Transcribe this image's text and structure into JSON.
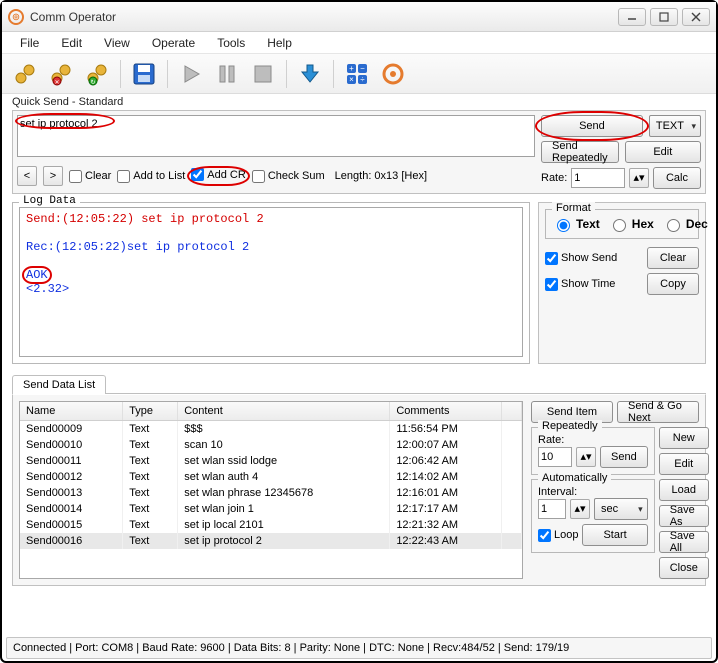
{
  "window": {
    "title": "Comm Operator"
  },
  "menu": [
    "File",
    "Edit",
    "View",
    "Operate",
    "Tools",
    "Help"
  ],
  "quicksend": {
    "panel_label": "Quick Send - Standard",
    "text": "set ip protocol 2",
    "clear": "Clear",
    "add_to_list": "Add to List",
    "add_cr": "Add CR",
    "checksum": "Check Sum",
    "length": "Length: 0x13 [Hex]",
    "send": "Send",
    "send_rep": "Send Repeatedly",
    "mode": "TEXT",
    "edit": "Edit",
    "rate_label": "Rate:",
    "rate_value": "1",
    "calc": "Calc"
  },
  "log": {
    "title": "Log Data",
    "line_send": "Send:(12:05:22) set ip protocol 2",
    "line_rec": "Rec:(12:05:22)set ip protocol 2",
    "line_aok": "AOK",
    "line_ver": "<2.32>"
  },
  "format": {
    "title": "Format",
    "text": "Text",
    "hex": "Hex",
    "dec": "Dec",
    "show_send": "Show Send",
    "show_time": "Show Time",
    "clear": "Clear",
    "copy": "Copy"
  },
  "sendlist": {
    "tab": "Send Data List",
    "cols": {
      "name": "Name",
      "type": "Type",
      "content": "Content",
      "comments": "Comments"
    },
    "rows": [
      {
        "name": "Send00009",
        "type": "Text",
        "content": "$$$",
        "comments": "11:56:54 PM"
      },
      {
        "name": "Send00010",
        "type": "Text",
        "content": "scan 10",
        "comments": "12:00:07 AM"
      },
      {
        "name": "Send00011",
        "type": "Text",
        "content": "set wlan ssid lodge",
        "comments": "12:06:42 AM"
      },
      {
        "name": "Send00012",
        "type": "Text",
        "content": "set wlan auth 4",
        "comments": "12:14:02 AM"
      },
      {
        "name": "Send00013",
        "type": "Text",
        "content": "set wlan phrase 12345678",
        "comments": "12:16:01 AM"
      },
      {
        "name": "Send00014",
        "type": "Text",
        "content": "set wlan join 1",
        "comments": "12:17:17 AM"
      },
      {
        "name": "Send00015",
        "type": "Text",
        "content": "set ip local 2101",
        "comments": "12:21:32 AM"
      },
      {
        "name": "Send00016",
        "type": "Text",
        "content": "set ip protocol 2",
        "comments": "12:22:43 AM"
      }
    ],
    "send_item": "Send Item",
    "send_go": "Send & Go Next",
    "repeatedly": "Repeatedly",
    "rate_label": "Rate:",
    "rate_value": "10",
    "send_btn": "Send",
    "automatically": "Automatically",
    "interval_label": "Interval:",
    "interval_value": "1",
    "interval_unit": "sec",
    "loop": "Loop",
    "start": "Start",
    "new": "New",
    "edit": "Edit",
    "load": "Load",
    "save_as": "Save As",
    "save_all": "Save All",
    "close": "Close"
  },
  "status": "Connected | Port: COM8 | Baud Rate: 9600 | Data Bits: 8 | Parity: None | DTC: None | Recv:484/52 | Send: 179/19"
}
